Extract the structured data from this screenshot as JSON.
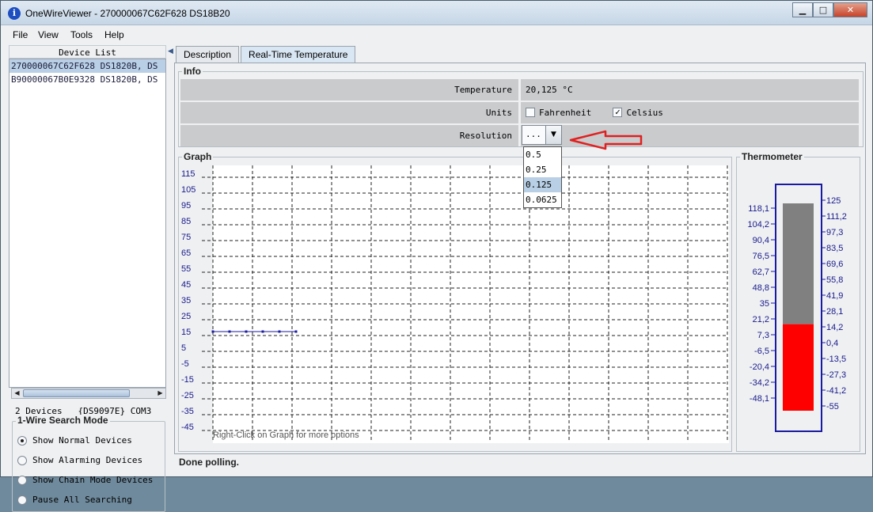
{
  "window": {
    "title": "OneWireViewer - 270000067C62F628 DS18B20",
    "buttons": {
      "minimize": "▁",
      "maximize": "□",
      "close": "✕"
    }
  },
  "menu": [
    "File",
    "View",
    "Tools",
    "Help"
  ],
  "device_list": {
    "header": "Device List",
    "items": [
      "270000067C62F628 DS1820B, DS",
      "B90000067B0E9328 DS1820B, DS"
    ],
    "selected_index": 0
  },
  "device_status": {
    "count": "2 Devices",
    "adapter": "{DS9097E}",
    "port": "COM3"
  },
  "search_mode": {
    "title": "1-Wire Search Mode",
    "options": [
      "Show Normal Devices",
      "Show Alarming Devices",
      "Show Chain Mode Devices",
      "Pause All Searching"
    ],
    "selected_index": 0
  },
  "tabs": [
    "Description",
    "Real-Time Temperature"
  ],
  "active_tab": 1,
  "info": {
    "title": "Info",
    "temperature_label": "Temperature",
    "temperature_value": "20,125 °C",
    "units_label": "Units",
    "fahrenheit_label": "Fahrenheit",
    "fahrenheit_checked": false,
    "celsius_label": "Celsius",
    "celsius_checked": true,
    "check_mark": "✓",
    "resolution_label": "Resolution",
    "resolution_value": "...",
    "resolution_arrow": "▼",
    "resolution_options": [
      "0.5",
      "0.25",
      "0.125",
      "0.0625"
    ],
    "resolution_highlighted_index": 2
  },
  "graph": {
    "title": "Graph",
    "y_ticks": [
      "115",
      "105",
      "95",
      "85",
      "75",
      "65",
      "55",
      "45",
      "35",
      "25",
      "15",
      "5",
      "-5",
      "-15",
      "-25",
      "-35",
      "-45"
    ],
    "hint": "Right-Click on Graph for more options",
    "series_color": "#1a1aa0",
    "samples": [
      17.5,
      17.5,
      17.5,
      17.5,
      17.5,
      17.5
    ]
  },
  "thermometer": {
    "title": "Thermometer",
    "fahrenheit_ticks": [
      "118,1",
      "104,2",
      "90,4",
      "76,5",
      "62,7",
      "48,8",
      "35",
      "21,2",
      "7,3",
      "-6,5",
      "-20,4",
      "-34,2",
      "-48,1"
    ],
    "celsius_ticks": [
      "125",
      "111,2",
      "97,3",
      "83,5",
      "69,6",
      "55,8",
      "41,9",
      "28,1",
      "14,2",
      "0,4",
      "-13,5",
      "-27,3",
      "-41,2",
      "-55"
    ],
    "current_celsius": 20.125,
    "range_celsius": [
      -55,
      125
    ],
    "fill_color": "#ff0000",
    "empty_color": "#808080",
    "frame_color": "#1a1aa0"
  },
  "status": "Done polling.",
  "annotation_arrow_color": "#e02020"
}
